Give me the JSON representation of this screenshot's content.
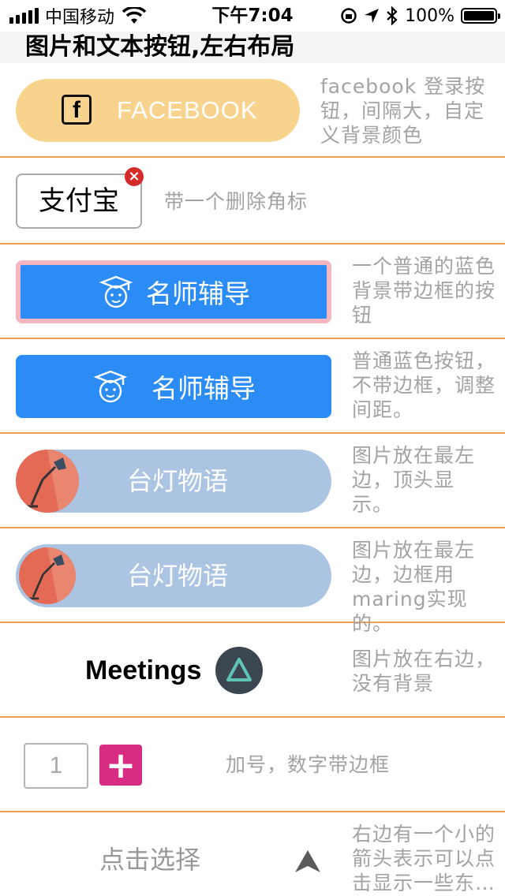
{
  "status_bar": {
    "carrier": "中国移动",
    "time": "下午7:04",
    "battery": "100%",
    "battery_level": 1.0
  },
  "nav": {
    "title": "图片和文本按钮,左右布局"
  },
  "rows": [
    {
      "button_label": "FACEBOOK",
      "icon_letter": "f",
      "desc": "facebook 登录按钮，间隔大，自定义背景颜色"
    },
    {
      "button_label": "支付宝",
      "badge_glyph": "×",
      "desc": "带一个删除角标"
    },
    {
      "button_label": "名师辅导",
      "desc": "一个普通的蓝色背景带边框的按钮"
    },
    {
      "button_label": "名师辅导",
      "desc": "普通蓝色按钮，不带边框，调整间距。"
    },
    {
      "button_label": "台灯物语",
      "desc": "图片放在最左边，顶头显示。"
    },
    {
      "button_label": "台灯物语",
      "desc": "图片放在最左边，边框用maring实现的。"
    },
    {
      "button_label": "Meetings",
      "desc": "图片放在右边，没有背景"
    },
    {
      "number_value": "1",
      "plus_label": "+",
      "desc": "加号，数字带边框"
    },
    {
      "button_label": "点击选择",
      "desc": "右边有一个小的箭头表示可以点击显示一些东…"
    }
  ],
  "colors": {
    "separator": "#f0a052",
    "facebook_bg": "#f8d38e",
    "blue": "#2b8cf6",
    "pink_border": "#f4b6c0",
    "lamp_bg": "#abc4e1",
    "lamp_circle": "#e56a55",
    "plus_bg": "#d82b82",
    "badge": "#d62a2a"
  }
}
